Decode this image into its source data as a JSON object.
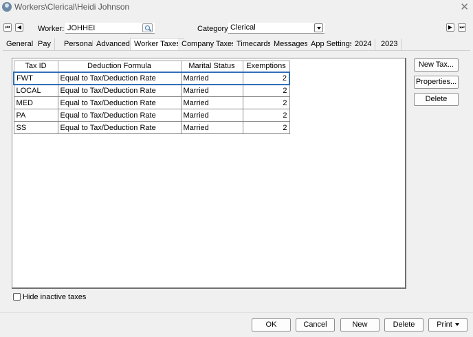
{
  "window": {
    "title": "Workers\\Clerical\\Heidi Johnson"
  },
  "worker": {
    "label": "Worker:",
    "value": "JOHHEI"
  },
  "category": {
    "label": "Category:",
    "value": "Clerical"
  },
  "tabs": [
    {
      "label": "General"
    },
    {
      "label": "Pay"
    },
    {
      "label": "Personal"
    },
    {
      "label": "Advanced"
    },
    {
      "label": "Worker Taxes"
    },
    {
      "label": "Company Taxes"
    },
    {
      "label": "Timecards"
    },
    {
      "label": "Messages"
    },
    {
      "label": "App Settings"
    },
    {
      "label": "2024"
    },
    {
      "label": "2023"
    }
  ],
  "grid": {
    "columns": [
      "Tax ID",
      "Deduction Formula",
      "Marital Status",
      "Exemptions"
    ],
    "rows": [
      {
        "tax_id": "FWT",
        "formula": "Equal to Tax/Deduction Rate",
        "marital": "Married",
        "exemptions": "2"
      },
      {
        "tax_id": "LOCAL",
        "formula": "Equal to Tax/Deduction Rate",
        "marital": "Married",
        "exemptions": "2"
      },
      {
        "tax_id": "MED",
        "formula": "Equal to Tax/Deduction Rate",
        "marital": "Married",
        "exemptions": "2"
      },
      {
        "tax_id": "PA",
        "formula": "Equal to Tax/Deduction Rate",
        "marital": "Married",
        "exemptions": "2"
      },
      {
        "tax_id": "SS",
        "formula": "Equal to Tax/Deduction Rate",
        "marital": "Married",
        "exemptions": "2"
      }
    ]
  },
  "side_buttons": {
    "new_tax": "New Tax...",
    "properties": "Properties...",
    "delete": "Delete"
  },
  "hide_inactive": {
    "label": "Hide inactive taxes"
  },
  "footer": {
    "ok": "OK",
    "cancel": "Cancel",
    "new": "New",
    "delete": "Delete",
    "print": "Print"
  }
}
